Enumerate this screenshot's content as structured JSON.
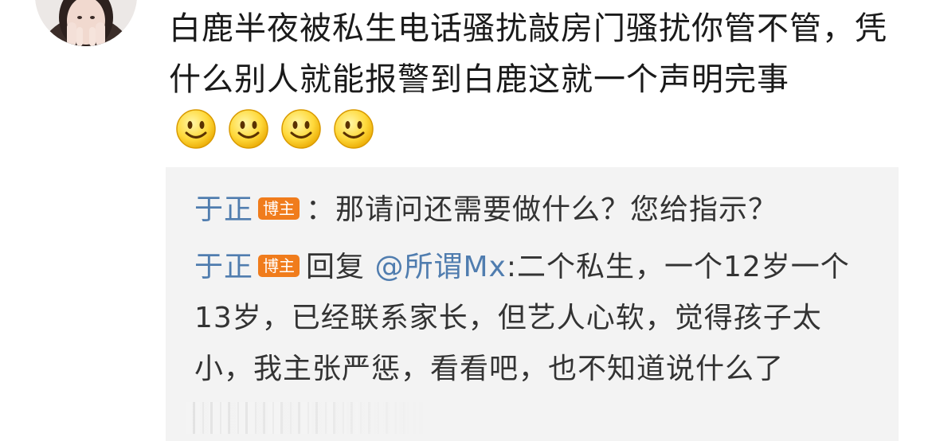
{
  "comment": {
    "text": "白鹿半夜被私生电话骚扰敲房门骚扰你管不管，凭什么别人就能报警到白鹿这就一个声明完事",
    "emojis": [
      "smile-emoji",
      "smile-emoji",
      "smile-emoji",
      "smile-emoji"
    ]
  },
  "replies": [
    {
      "author": "于正",
      "badge": "博主",
      "separator": "：",
      "text": "那请问还需要做什么？您给指示？"
    },
    {
      "author": "于正",
      "badge": "博主",
      "reply_prefix": "回复",
      "mention": "@所谓Mx",
      "separator": ":",
      "text": "二个私生，一个12岁一个13岁，已经联系家长，但艺人心软，觉得孩子太小，我主张严惩，看看吧，也不知道说什么了"
    }
  ],
  "colors": {
    "author": "#507daf",
    "badge": "#f07c1c",
    "reply_background": "#f3f3f3",
    "text": "#1a1a1a"
  }
}
